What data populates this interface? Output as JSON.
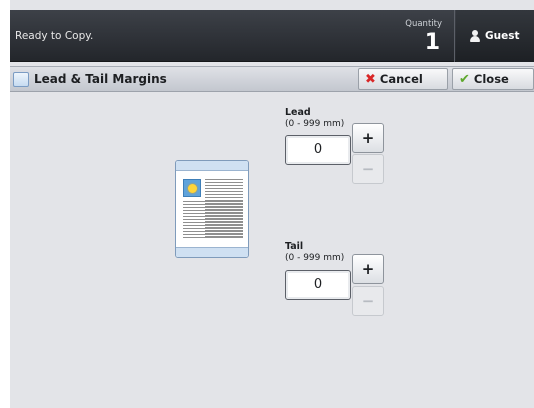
{
  "status": {
    "text": "Ready to Copy.",
    "quantity_label": "Quantity",
    "quantity_value": "1"
  },
  "user": {
    "label": "Guest",
    "icon": "user-icon"
  },
  "panel": {
    "title": "Lead & Tail Margins",
    "title_icon": "panel-icon",
    "cancel_label": "Cancel",
    "close_label": "Close"
  },
  "lead": {
    "label": "Lead",
    "range": "(0 - 999 mm)",
    "value": "0",
    "plus": "+",
    "minus": "−"
  },
  "tail": {
    "label": "Tail",
    "range": "(0 - 999 mm)",
    "value": "0",
    "plus": "+",
    "minus": "−"
  },
  "colors": {
    "accent_cancel": "#d92727",
    "accent_close": "#5ea82c",
    "header_dark": "#23262b"
  }
}
